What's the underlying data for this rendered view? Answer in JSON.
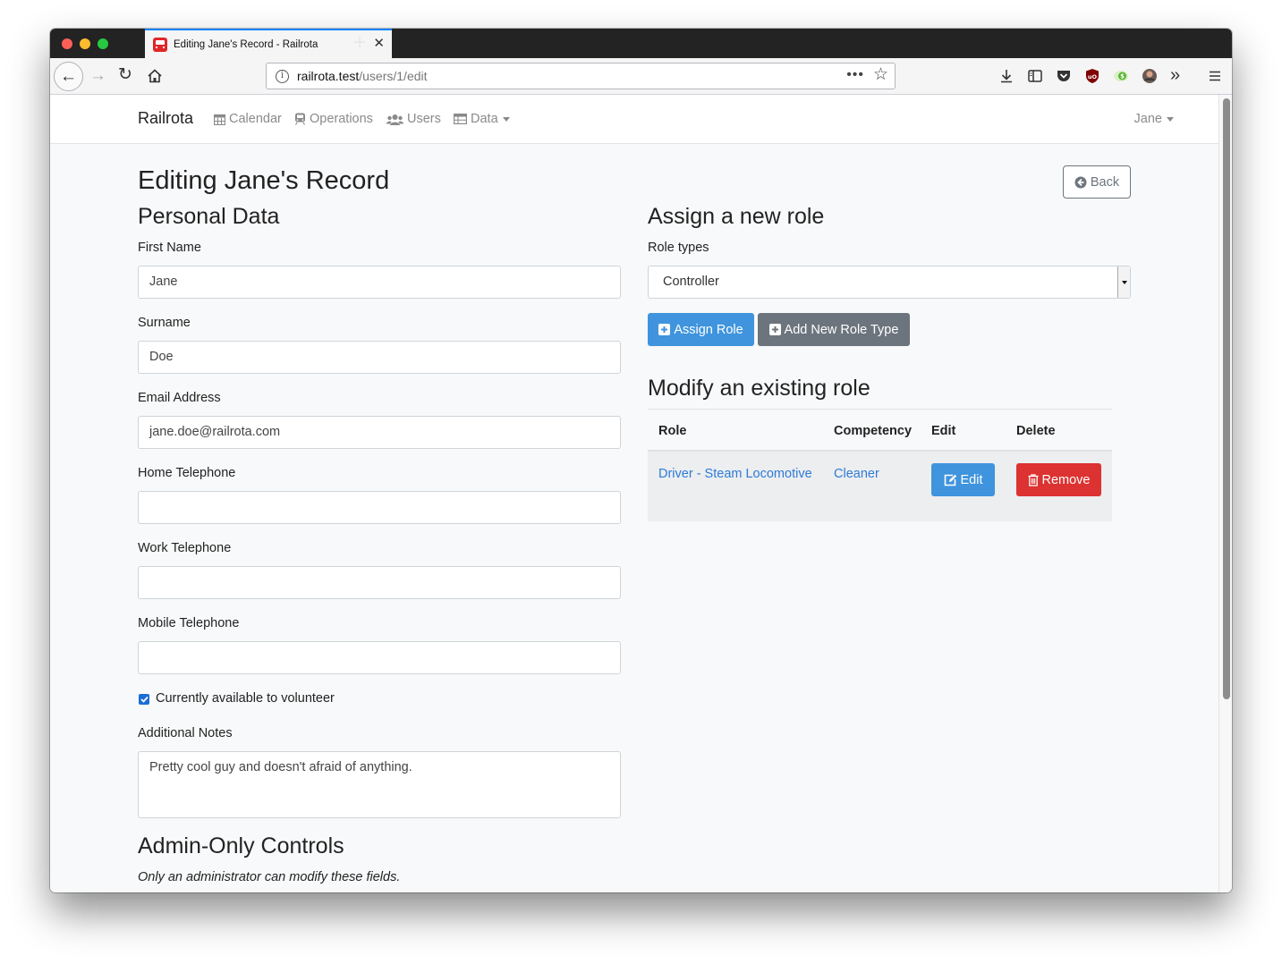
{
  "browser": {
    "tab_title": "Editing Jane's Record - Railrota",
    "url_host": "railrota.test",
    "url_path": "/users/1/edit"
  },
  "navbar": {
    "brand": "Railrota",
    "items": [
      {
        "label": "Calendar",
        "icon": "calendar-icon"
      },
      {
        "label": "Operations",
        "icon": "train-icon"
      },
      {
        "label": "Users",
        "icon": "users-icon"
      },
      {
        "label": "Data",
        "icon": "table-icon"
      }
    ],
    "user": "Jane"
  },
  "page": {
    "title": "Editing Jane's Record",
    "back_label": "Back"
  },
  "personal": {
    "heading": "Personal Data",
    "first_name_label": "First Name",
    "first_name_value": "Jane",
    "surname_label": "Surname",
    "surname_value": "Doe",
    "email_label": "Email Address",
    "email_value": "jane.doe@railrota.com",
    "home_tel_label": "Home Telephone",
    "home_tel_value": "",
    "work_tel_label": "Work Telephone",
    "work_tel_value": "",
    "mobile_tel_label": "Mobile Telephone",
    "mobile_tel_value": "",
    "available_label": "Currently available to volunteer",
    "available_checked": true,
    "notes_label": "Additional Notes",
    "notes_value": "Pretty cool guy and doesn't afraid of anything."
  },
  "admin": {
    "heading": "Admin-Only Controls",
    "note": "Only an administrator can modify these fields."
  },
  "assign": {
    "heading": "Assign a new role",
    "role_types_label": "Role types",
    "selected_role_type": "Controller",
    "assign_button": "Assign Role",
    "add_type_button": "Add New Role Type"
  },
  "modify": {
    "heading": "Modify an existing role",
    "columns": [
      "Role",
      "Competency",
      "Edit",
      "Delete"
    ],
    "rows": [
      {
        "role": "Driver - Steam Locomotive",
        "competency": "Cleaner",
        "edit_label": "Edit",
        "delete_label": "Remove"
      }
    ]
  },
  "colors": {
    "primary": "#3f94dd",
    "secondary": "#6c757d",
    "danger": "#dc3231",
    "link": "#2f7ad6"
  }
}
